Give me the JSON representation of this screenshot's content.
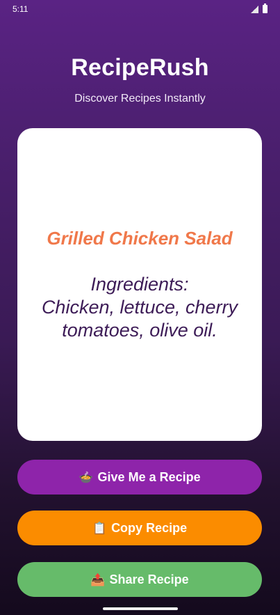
{
  "status_bar": {
    "time": "5:11"
  },
  "header": {
    "title": "RecipeRush",
    "subtitle": "Discover Recipes Instantly"
  },
  "recipe": {
    "name": "Grilled Chicken Salad",
    "ingredients_line1": "Ingredients:",
    "ingredients_line2": "Chicken, lettuce, cherry",
    "ingredients_line3": "tomatoes, olive oil."
  },
  "buttons": {
    "give_recipe": {
      "icon": "🍲",
      "label": "Give Me a Recipe",
      "color": "#8e24aa"
    },
    "copy_recipe": {
      "icon": "📋",
      "label": "Copy Recipe",
      "color": "#fb8c00"
    },
    "share_recipe": {
      "icon": "📤",
      "label": "Share Recipe",
      "color": "#66bb6a"
    }
  },
  "colors": {
    "recipe_name": "#f0784a",
    "ingredients_text": "#3d1c57",
    "background_top": "#5a2384",
    "background_bottom": "#140a1d"
  }
}
